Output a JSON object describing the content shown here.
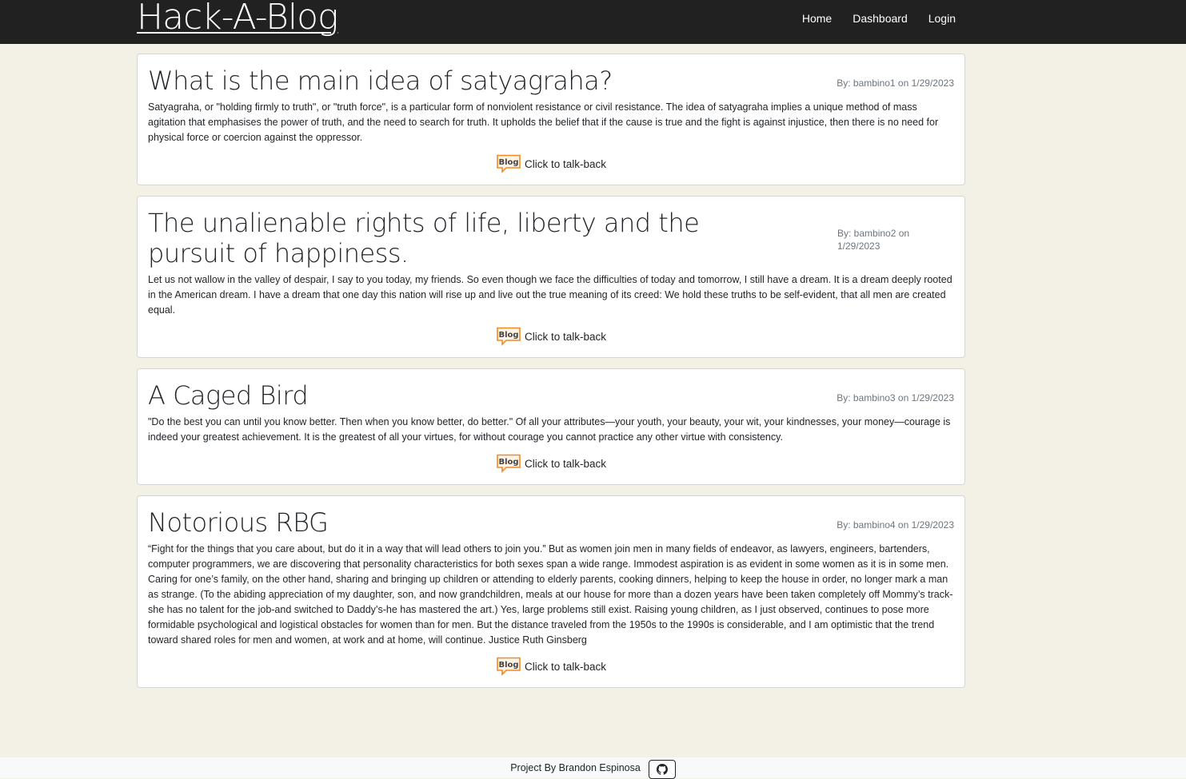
{
  "app": {
    "brand": "Hack-A-Blog"
  },
  "nav": {
    "home": "Home",
    "dashboard": "Dashboard",
    "login": "Login"
  },
  "posts": [
    {
      "title": "What is the main idea of satyagraha?",
      "byline": "By: bambino1 on 1/29/2023",
      "body": "Satyagraha, or \"holding firmly to truth\", or \"truth force\", is a particular form of nonviolent resistance or civil resistance. The idea of satyagraha implies a unique method of mass agitation that emphasises the power of truth, and the need to search for truth. It upholds the belief that if the cause is true and the fight is against injustice, then there is no need for physical force or coercion against the oppressor.",
      "talkback": "Click to talk-back"
    },
    {
      "title": "The unalienable rights of life, liberty and the pursuit of happiness.",
      "byline": "By: bambino2 on 1/29/2023",
      "body": "Let us not wallow in the valley of despair, I say to you today, my friends. So even though we face the difficulties of today and tomorrow, I still have a dream. It is a dream deeply rooted in the American dream. I have a dream that one day this nation will rise up and live out the true meaning of its creed: We hold these truths to be self-evident, that all men are created equal.",
      "talkback": "Click to talk-back"
    },
    {
      "title": "A Caged Bird",
      "byline": "By: bambino3 on 1/29/2023",
      "body": "\"Do the best you can until you know better. Then when you know better, do better.\" Of all your attributes—your youth, your beauty, your wit, your kindnesses, your money—courage is indeed your greatest achievement. It is the greatest of all your virtues, for without courage you cannot practice any other virtue with consistency.",
      "talkback": "Click to talk-back"
    },
    {
      "title": "Notorious RBG",
      "byline": "By: bambino4 on 1/29/2023",
      "body": "“Fight for the things that you care about, but do it in a way that will lead others to join you.” But as women join men in many fields of endeavor, as lawyers, engineers, bartenders, computer programmers, we are discovering that personality characteristics for both sexes span a wide range. Immodest aspiration is as evident in some women as it is in some men. Caring for one’s family, on the other hand, sharing and bringing up children or attending to elderly parents, cooking dinners, helping to keep the house in order, no longer mark a man as strange. (To the abiding appreciation of my daughter, son, and now grandchildren, meals at our house for more than a dozen years have been taken completely off Mommy’s track-she has no talent for the job-and switched to Daddy’s-he has mastered the art.) Yes, large problems still exist. Raising young children, as I just observed, continues to pose more formidable psychological and logistical obstacles for women than for men. But the distance traveled from the 1950s to the 1990s is considerable, and I am optimistic that the trend toward shared roles for men and women, at work and at home, will continue. Justice Ruth Ginsberg",
      "talkback": "Click to talk-back"
    }
  ],
  "blog_icon": {
    "name": "blog-speech-bubble-icon",
    "text": "Blog",
    "color": "#f08a24"
  },
  "footer": {
    "credit": "Project By Brandon Espinosa",
    "icon": "github-icon"
  }
}
